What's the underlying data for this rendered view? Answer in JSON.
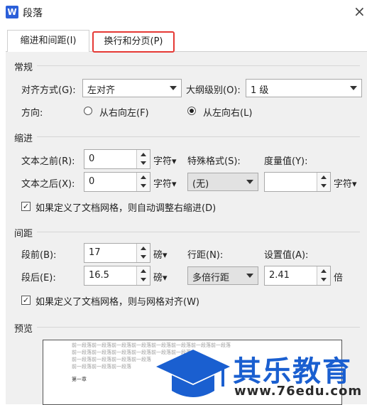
{
  "window": {
    "logo": "W",
    "title": "段落",
    "close": "×"
  },
  "tabs": [
    {
      "label": "缩进和间距(I)"
    },
    {
      "label": "换行和分页(P)"
    }
  ],
  "general": {
    "heading": "常规",
    "alignment": {
      "label": "对齐方式(G):",
      "value": "左对齐"
    },
    "outline": {
      "label": "大纲级别(O):",
      "value": "1 级"
    },
    "direction": {
      "label": "方向:",
      "rtl": "从右向左(F)",
      "ltr": "从左向右(L)",
      "selected": "ltr"
    }
  },
  "indent": {
    "heading": "缩进",
    "before": {
      "label": "文本之前(R):",
      "value": "0",
      "unit": "字符▾"
    },
    "after": {
      "label": "文本之后(X):",
      "value": "0",
      "unit": "字符▾"
    },
    "special": {
      "label": "特殊格式(S):",
      "value": "(无)"
    },
    "measure": {
      "label": "度量值(Y):",
      "value": "",
      "unit": "字符▾"
    },
    "checkbox": {
      "label": "如果定义了文档网格，则自动调整右缩进(D)",
      "checked": true
    }
  },
  "spacing": {
    "heading": "间距",
    "before": {
      "label": "段前(B):",
      "value": "17",
      "unit": "磅▾"
    },
    "after": {
      "label": "段后(E):",
      "value": "16.5",
      "unit": "磅▾"
    },
    "line": {
      "label": "行距(N):",
      "value": "多倍行距"
    },
    "setting": {
      "label": "设置值(A):",
      "value": "2.41",
      "unit": "倍"
    },
    "checkbox": {
      "label": "如果定义了文档网格，则与网格对齐(W)",
      "checked": true
    }
  },
  "preview": {
    "heading": "预览",
    "lines": [
      "前一段落前一段落前一段落前一段落前一段落前一段落前一段落前一段落",
      "前一段落前一段落前一段落前一段落前一段落前一段落",
      "前一段落前一段落前一段落前一段落",
      "前一段落前一段落前一段落"
    ],
    "sample": "第一章"
  },
  "watermark": {
    "brand": "其乐教育",
    "url": "www.76edu.com",
    "icon": "graduation-cap-icon",
    "color": "#1a5fd0"
  }
}
